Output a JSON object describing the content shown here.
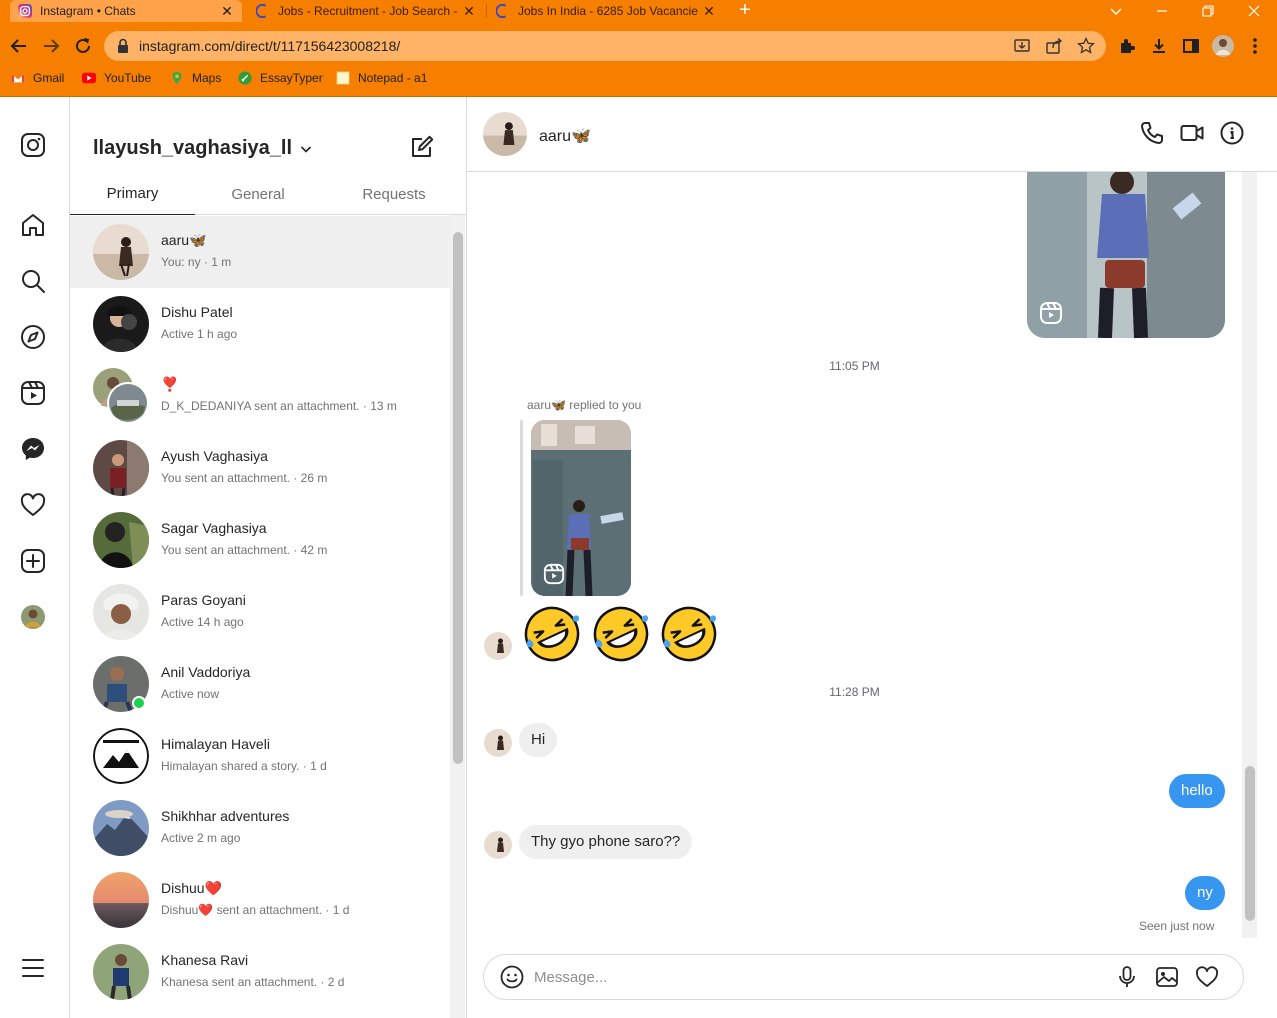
{
  "browser": {
    "tabs": [
      {
        "title": "Instagram • Chats",
        "active": true
      },
      {
        "title": "Jobs - Recruitment - Job Search -",
        "active": false
      },
      {
        "title": "Jobs In India - 6285 Job Vacancie",
        "active": false
      }
    ],
    "url": "instagram.com/direct/t/117156423008218/",
    "bookmarks": [
      "Gmail",
      "YouTube",
      "Maps",
      "EssayTyper",
      "Notepad - a1"
    ],
    "theme_color": "#f77f00"
  },
  "inbox": {
    "username": "llayush_vaghasiya_ll",
    "tabs": [
      "Primary",
      "General",
      "Requests"
    ],
    "conversations": [
      {
        "name": "aaru🦋",
        "preview": "You: ny · 1 m",
        "selected": true
      },
      {
        "name": "Dishu Patel",
        "preview": "Active 1 h ago"
      },
      {
        "name": "❣️",
        "preview": "D_K_DEDANIYA sent an attachment. · 13 m"
      },
      {
        "name": "Ayush Vaghasiya",
        "preview": "You sent an attachment. · 26 m"
      },
      {
        "name": "Sagar Vaghasiya",
        "preview": "You sent an attachment. · 42 m"
      },
      {
        "name": "Paras Goyani",
        "preview": "Active 14 h ago"
      },
      {
        "name": "Anil Vaddoriya",
        "preview": "Active now",
        "online": true
      },
      {
        "name": "Himalayan Haveli",
        "preview": "Himalayan shared a story. · 1 d"
      },
      {
        "name": "Shikhhar adventures",
        "preview": "Active 2 m ago"
      },
      {
        "name": "Dishuu❤️",
        "preview": "Dishuu❤️ sent an attachment. · 1 d"
      },
      {
        "name": "Khanesa Ravi",
        "preview": "Khanesa sent an attachment. · 2 d"
      }
    ]
  },
  "chat": {
    "contact_name": "aaru🦋",
    "messages": {
      "time1": "11:05 PM",
      "reply_label": "aaru🦋 replied to you",
      "emojis": "🤣🤣🤣",
      "time2": "11:28 PM",
      "in1": "Hi",
      "out1": "hello",
      "in2": "Thy gyo phone saro??",
      "out2": "ny",
      "seen": "Seen just now"
    },
    "composer_placeholder": "Message...",
    "outgoing_color": "#3797f0"
  }
}
